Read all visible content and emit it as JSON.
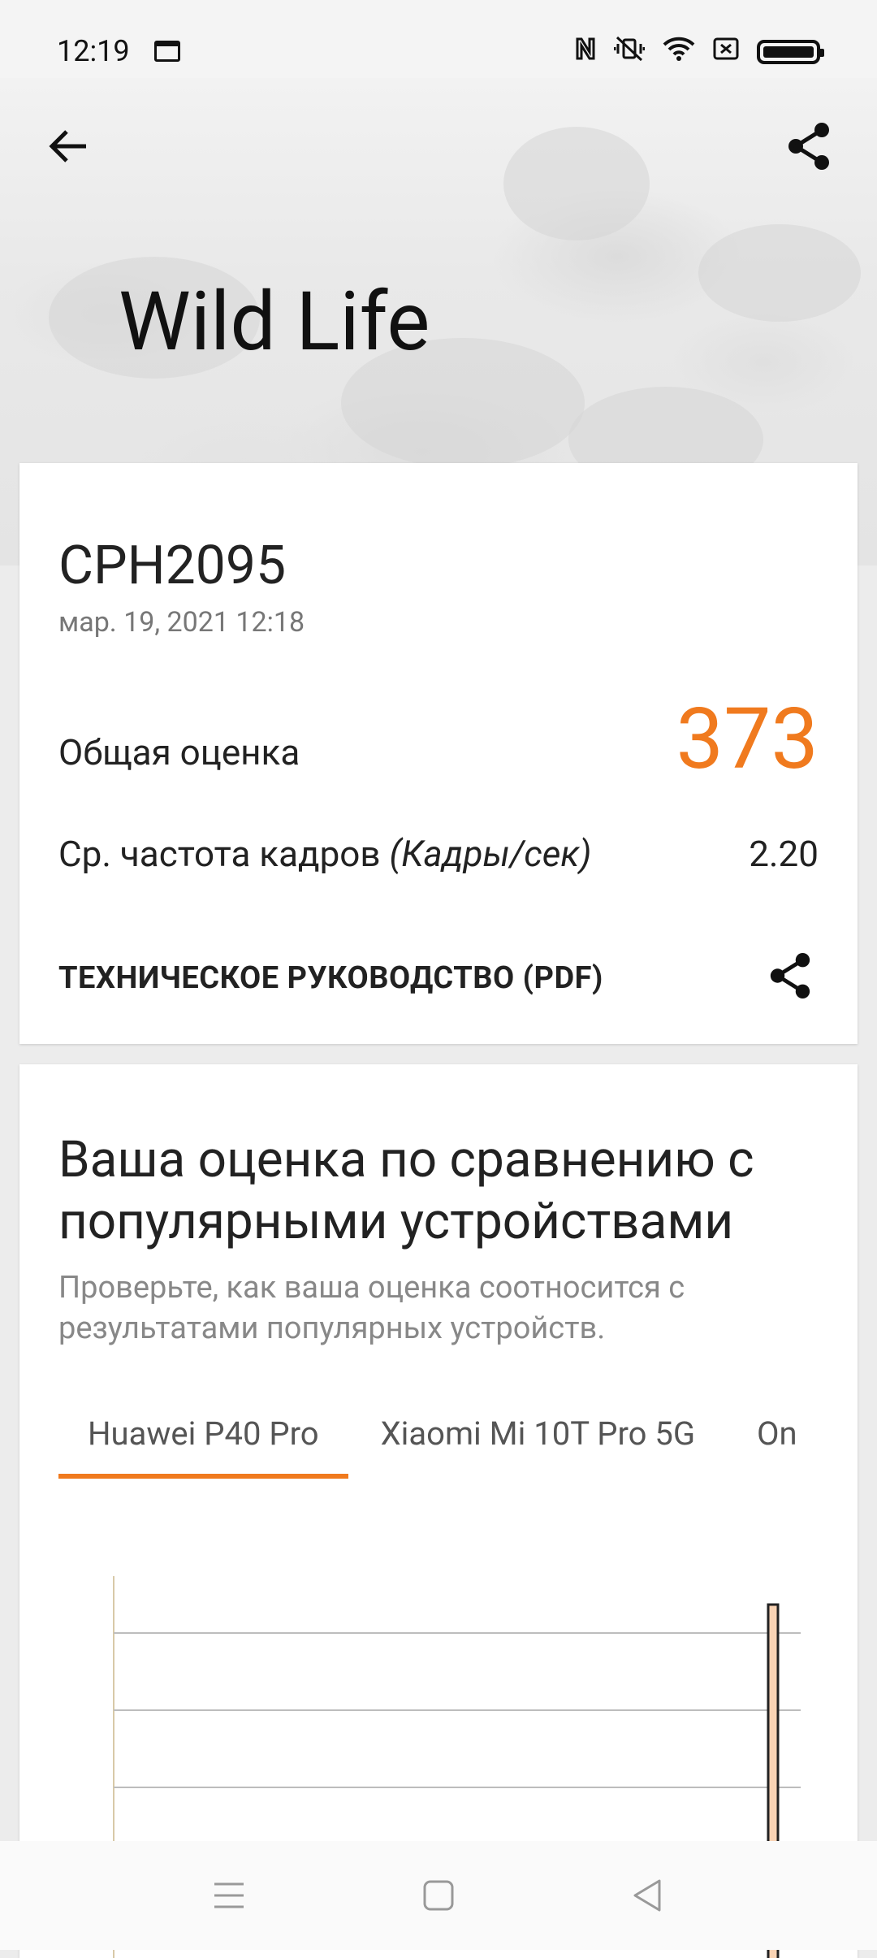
{
  "status_bar": {
    "time": "12:19"
  },
  "hero": {
    "title": "Wild Life"
  },
  "result_card": {
    "device": "CPH2095",
    "date": "мар. 19, 2021 12:18",
    "score_label": "Общая оценка",
    "score_value": "373",
    "fps_label": "Ср. частота кадров",
    "fps_unit": "(Кадры/сек)",
    "fps_value": "2.20",
    "guide_label": "ТЕХНИЧЕСКОЕ РУКОВОДСТВО (PDF)"
  },
  "comparison": {
    "title": "Ваша оценка по сравнению с популярными устройствами",
    "subtitle": "Проверьте, как ваша оценка соотносится с результатами популярных устройств.",
    "tabs": [
      "Huawei P40 Pro",
      "Xiaomi Mi 10T Pro 5G",
      "On"
    ],
    "active_tab": 0
  },
  "colors": {
    "accent": "#f07a1e",
    "bar_fill": "#f9d3b4",
    "bar_stroke": "#222222",
    "axis": "#d8c9a8",
    "grid": "#bdbdbd"
  },
  "chart_data": {
    "type": "bar",
    "grid": true
  }
}
